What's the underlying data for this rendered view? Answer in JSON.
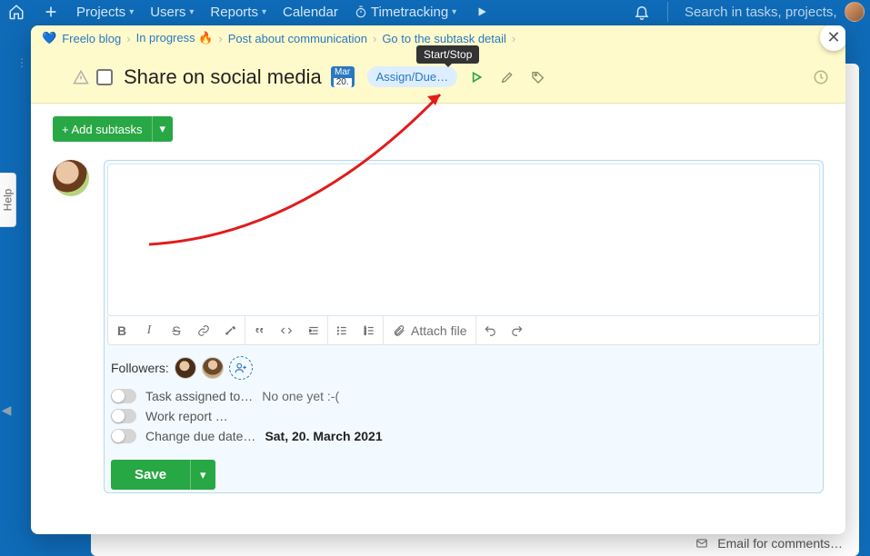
{
  "nav": {
    "projects": "Projects",
    "users": "Users",
    "reports": "Reports",
    "calendar": "Calendar",
    "timetracking": "Timetracking",
    "search_placeholder": "Search in tasks, projects, u"
  },
  "help_tab": "Help",
  "breadcrumbs": {
    "b1": "Freelo blog",
    "b2": "In progress 🔥",
    "b3": "Post about communication",
    "b4": "Go to the subtask detail"
  },
  "task": {
    "title": "Share on social media",
    "date_month": "Mar",
    "date_day": "20.",
    "assign_label": "Assign/Due…"
  },
  "tooltip_startstop": "Start/Stop",
  "add_subtasks": "+ Add subtasks",
  "attach_label": "Attach file",
  "followers_label": "Followers:",
  "opts": {
    "assigned_label": "Task assigned to…",
    "assigned_value": "No one yet :-(",
    "work_report_label": "Work report …",
    "due_label": "Change due date…",
    "due_value": "Sat, 20. March 2021"
  },
  "save_label": "Save",
  "email_comments": "Email for comments…"
}
